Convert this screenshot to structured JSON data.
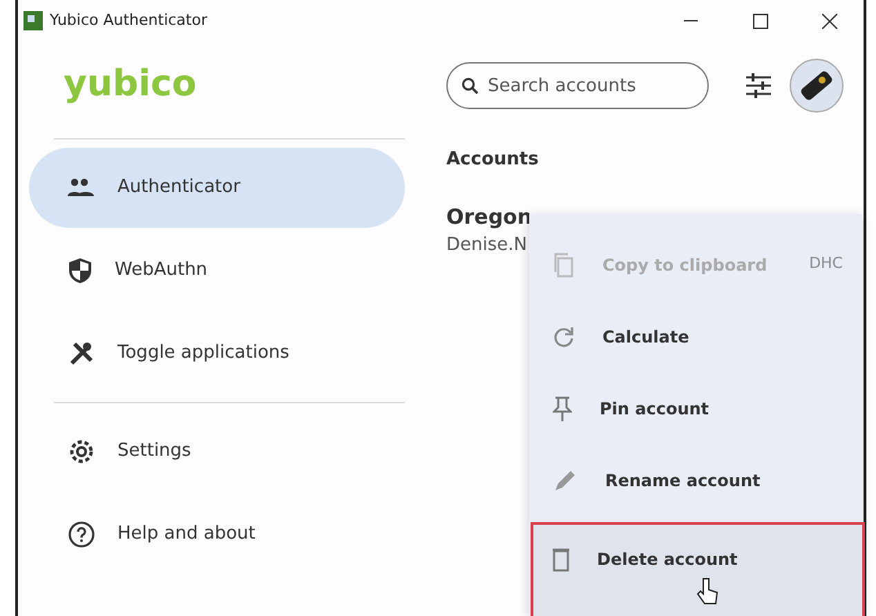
{
  "window": {
    "title": "Yubico Authenticator"
  },
  "logo": "yubico",
  "sidebar": {
    "items": [
      {
        "label": "Authenticator",
        "selected": true
      },
      {
        "label": "WebAuthn",
        "selected": false
      },
      {
        "label": "Toggle applications",
        "selected": false
      }
    ],
    "footer_items": [
      {
        "label": "Settings",
        "selected": false
      },
      {
        "label": "Help and about",
        "selected": false
      }
    ]
  },
  "search": {
    "placeholder": "Search accounts"
  },
  "section_title": "Accounts",
  "account": {
    "name": "Oregon",
    "subtitle": "Denise.N"
  },
  "context_menu": {
    "items": [
      {
        "label": "Copy to clipboard",
        "disabled": true,
        "shortcut": "DHC",
        "highlighted": false
      },
      {
        "label": "Calculate",
        "disabled": false,
        "highlighted": false
      },
      {
        "label": "Pin account",
        "disabled": false,
        "highlighted": false
      },
      {
        "label": "Rename account",
        "disabled": false,
        "highlighted": false
      },
      {
        "label": "Delete account",
        "disabled": false,
        "highlighted": true
      }
    ]
  }
}
